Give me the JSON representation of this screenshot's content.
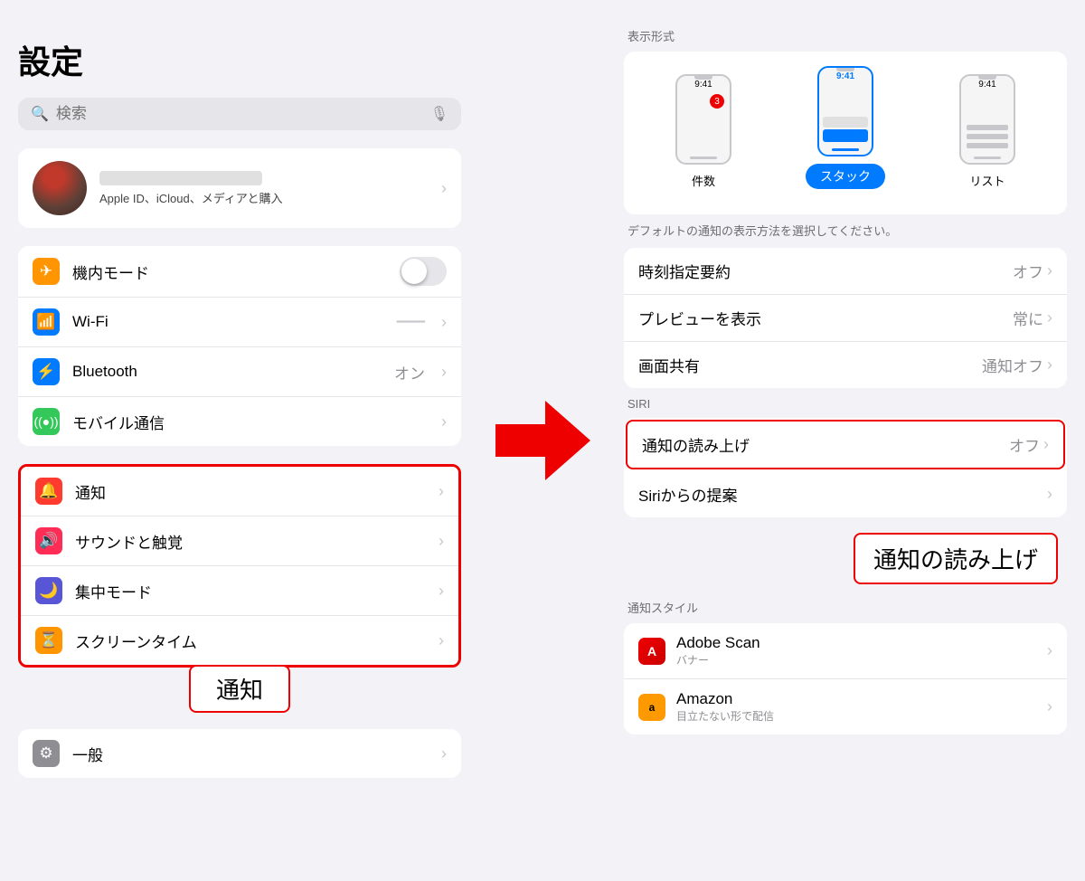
{
  "left": {
    "title": "設定",
    "search": {
      "placeholder": "検索"
    },
    "profile": {
      "sub": "Apple ID、iCloud、メディアと購入"
    },
    "group1": [
      {
        "icon": "airplane",
        "iconColor": "icon-orange",
        "label": "機内モード",
        "type": "toggle"
      },
      {
        "icon": "wifi",
        "iconColor": "icon-blue",
        "label": "Wi-Fi",
        "value": "",
        "type": "chevron"
      },
      {
        "icon": "bluetooth",
        "iconColor": "icon-blue2",
        "label": "Bluetooth",
        "value": "オン",
        "type": "chevron"
      },
      {
        "icon": "signal",
        "iconColor": "icon-green",
        "label": "モバイル通信",
        "value": "",
        "type": "chevron"
      }
    ],
    "group2": [
      {
        "icon": "bell",
        "iconColor": "icon-red",
        "label": "通知",
        "value": "",
        "type": "chevron",
        "highlight": true
      },
      {
        "icon": "sound",
        "iconColor": "icon-pink",
        "label": "サウンドと触覚",
        "value": "",
        "type": "chevron"
      },
      {
        "icon": "moon",
        "iconColor": "icon-purple",
        "label": "集中モード",
        "value": "",
        "type": "chevron"
      },
      {
        "icon": "hourglass",
        "iconColor": "icon-orange2",
        "label": "スクリーンタイム",
        "value": "",
        "type": "chevron"
      }
    ],
    "group3": [
      {
        "icon": "gear",
        "iconColor": "icon-gray",
        "label": "一般",
        "value": "",
        "type": "chevron"
      }
    ],
    "tsuuchi_callout": "通知"
  },
  "right": {
    "display_section_label": "表示形式",
    "display_options": [
      {
        "id": "count",
        "label": "件数",
        "selected": false
      },
      {
        "id": "stack",
        "label": "スタック",
        "selected": true
      },
      {
        "id": "list",
        "label": "リスト",
        "selected": false
      }
    ],
    "stack_selected_label": "スタック",
    "default_desc": "デフォルトの通知の表示方法を選択してください。",
    "settings_rows": [
      {
        "label": "時刻指定要約",
        "value": "オフ",
        "type": "chevron"
      },
      {
        "label": "プレビューを表示",
        "value": "常に",
        "type": "chevron"
      },
      {
        "label": "画面共有",
        "value": "通知オフ",
        "type": "chevron"
      }
    ],
    "siri_label": "SIRI",
    "siri_rows": [
      {
        "label": "通知の読み上げ",
        "value": "オフ",
        "type": "chevron",
        "highlight": true
      },
      {
        "label": "Siriからの提案",
        "value": "",
        "type": "chevron"
      }
    ],
    "notification_style_label": "通知スタイル",
    "apps": [
      {
        "name": "Adobe Scan",
        "sub": "バナー",
        "iconType": "adobe"
      },
      {
        "name": "Amazon",
        "sub": "目立たない形で配信",
        "iconType": "amazon"
      }
    ],
    "tsuuchi_yomage_callout": "通知の読み上げ",
    "time": "9:41"
  }
}
